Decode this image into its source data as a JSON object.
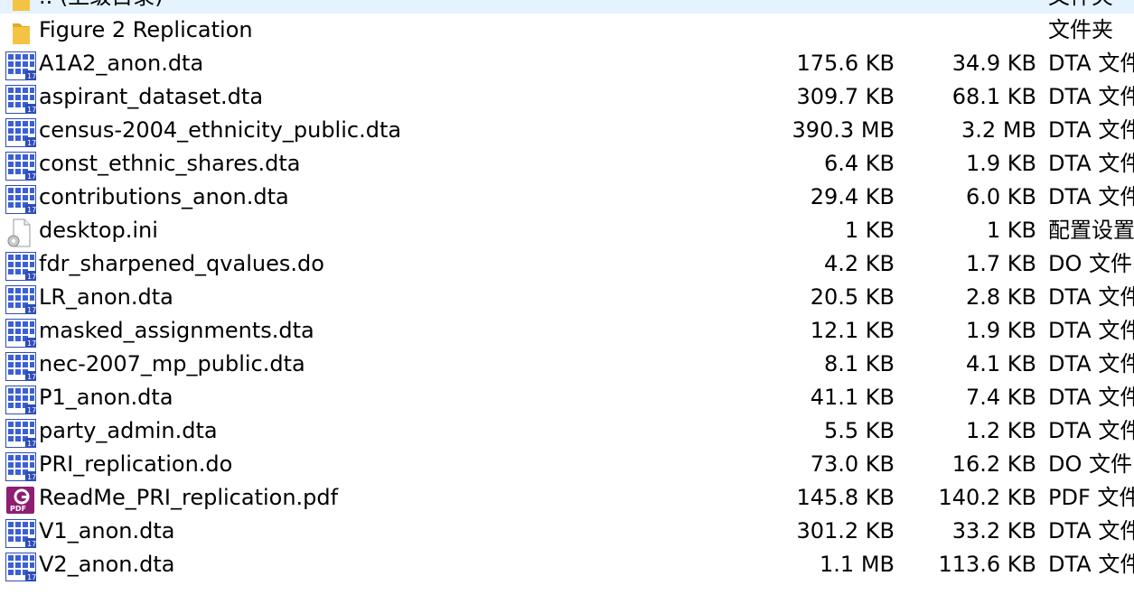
{
  "files": [
    {
      "icon": "folder-icon",
      "name": ".. (上级目录)",
      "size": "",
      "packed": "",
      "type": "文件夹"
    },
    {
      "icon": "folder-icon",
      "name": "Figure 2 Replication",
      "size": "",
      "packed": "",
      "type": "文件夹"
    },
    {
      "icon": "stata-data-icon",
      "name": "A1A2_anon.dta",
      "size": "175.6 KB",
      "packed": "34.9 KB",
      "type": "DTA 文件"
    },
    {
      "icon": "stata-data-icon",
      "name": "aspirant_dataset.dta",
      "size": "309.7 KB",
      "packed": "68.1 KB",
      "type": "DTA 文件"
    },
    {
      "icon": "stata-data-icon",
      "name": "census-2004_ethnicity_public.dta",
      "size": "390.3 MB",
      "packed": "3.2 MB",
      "type": "DTA 文件"
    },
    {
      "icon": "stata-data-icon",
      "name": "const_ethnic_shares.dta",
      "size": "6.4 KB",
      "packed": "1.9 KB",
      "type": "DTA 文件"
    },
    {
      "icon": "stata-data-icon",
      "name": "contributions_anon.dta",
      "size": "29.4 KB",
      "packed": "6.0 KB",
      "type": "DTA 文件"
    },
    {
      "icon": "settings-file-icon",
      "name": "desktop.ini",
      "size": "1 KB",
      "packed": "1 KB",
      "type": "配置设置"
    },
    {
      "icon": "stata-data-icon",
      "name": "fdr_sharpened_qvalues.do",
      "size": "4.2 KB",
      "packed": "1.7 KB",
      "type": "DO 文件"
    },
    {
      "icon": "stata-data-icon",
      "name": "LR_anon.dta",
      "size": "20.5 KB",
      "packed": "2.8 KB",
      "type": "DTA 文件"
    },
    {
      "icon": "stata-data-icon",
      "name": "masked_assignments.dta",
      "size": "12.1 KB",
      "packed": "1.9 KB",
      "type": "DTA 文件"
    },
    {
      "icon": "stata-data-icon",
      "name": "nec-2007_mp_public.dta",
      "size": "8.1 KB",
      "packed": "4.1 KB",
      "type": "DTA 文件"
    },
    {
      "icon": "stata-data-icon",
      "name": "P1_anon.dta",
      "size": "41.1 KB",
      "packed": "7.4 KB",
      "type": "DTA 文件"
    },
    {
      "icon": "stata-data-icon",
      "name": "party_admin.dta",
      "size": "5.5 KB",
      "packed": "1.2 KB",
      "type": "DTA 文件"
    },
    {
      "icon": "stata-data-icon",
      "name": "PRI_replication.do",
      "size": "73.0 KB",
      "packed": "16.2 KB",
      "type": "DO 文件"
    },
    {
      "icon": "pdf-icon",
      "name": "ReadMe_PRI_replication.pdf",
      "size": "145.8 KB",
      "packed": "140.2 KB",
      "type": "PDF 文件"
    },
    {
      "icon": "stata-data-icon",
      "name": "V1_anon.dta",
      "size": "301.2 KB",
      "packed": "33.2 KB",
      "type": "DTA 文件"
    },
    {
      "icon": "stata-data-icon",
      "name": "V2_anon.dta",
      "size": "1.1 MB",
      "packed": "113.6 KB",
      "type": "DTA 文件"
    }
  ],
  "colors": {
    "folder": "#f5c343",
    "stata_blue": "#3b5fd6",
    "pdf_purple": "#8e1e72",
    "hover": "#e5f3ff"
  }
}
